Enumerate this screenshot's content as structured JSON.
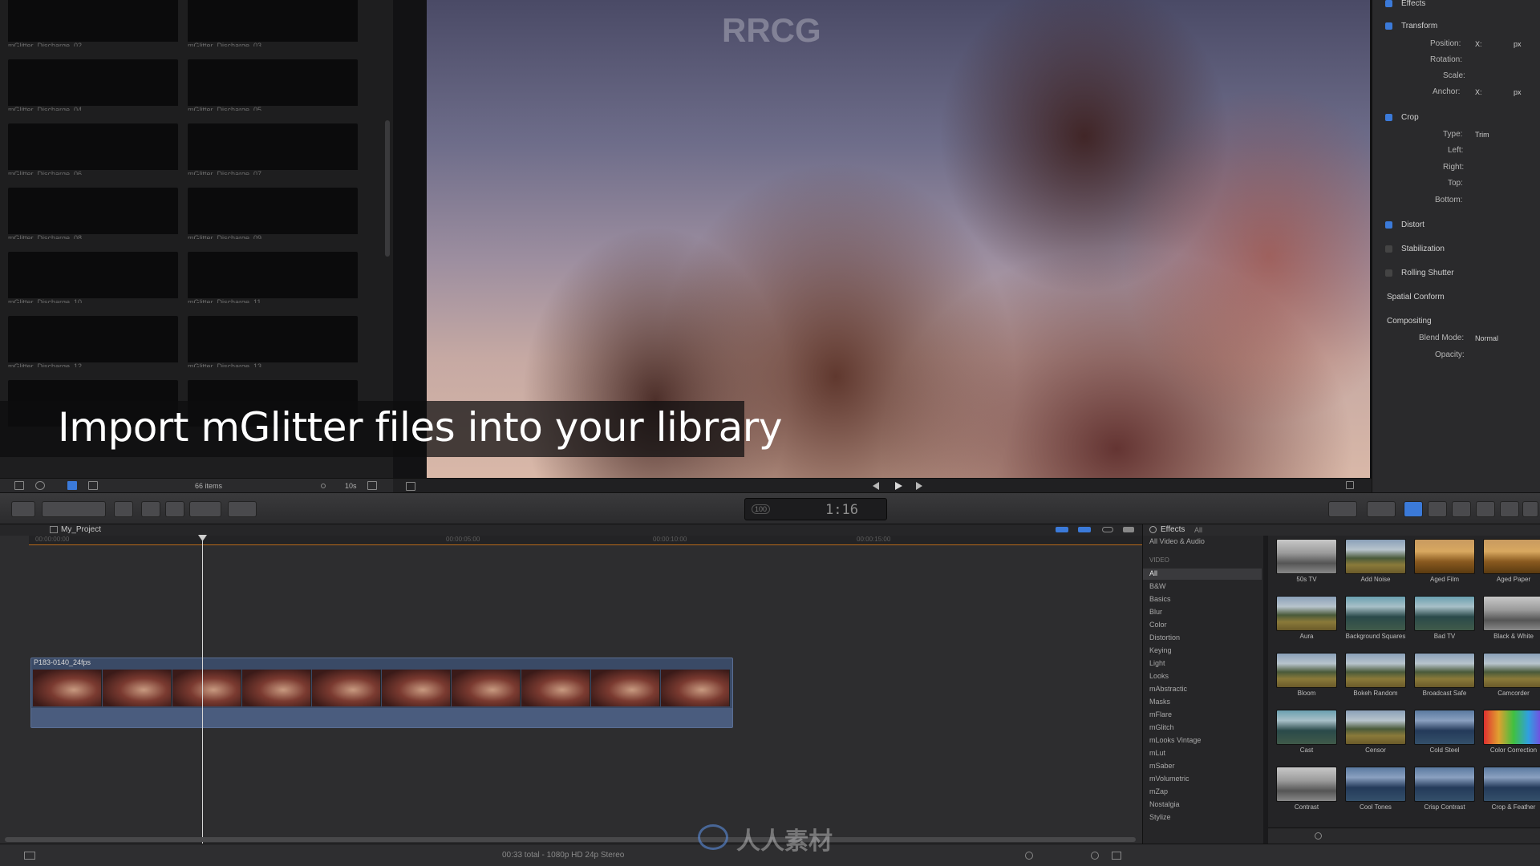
{
  "browser": {
    "clips": [
      {
        "name": "mGlitter_Discharge_02",
        "tint": "g-blue"
      },
      {
        "name": "mGlitter_Discharge_03",
        "tint": "g-stars"
      },
      {
        "name": "mGlitter_Discharge_04",
        "tint": "g-red"
      },
      {
        "name": "mGlitter_Discharge_05",
        "tint": "g-amber"
      },
      {
        "name": "mGlitter_Discharge_06",
        "tint": "g-dim"
      },
      {
        "name": "mGlitter_Discharge_07",
        "tint": "g-silver"
      },
      {
        "name": "mGlitter_Discharge_08",
        "tint": "g-gold"
      },
      {
        "name": "mGlitter_Discharge_09",
        "tint": "g-speck"
      },
      {
        "name": "mGlitter_Discharge_10",
        "tint": "g-cloud"
      },
      {
        "name": "mGlitter_Discharge_11",
        "tint": "g-cloud"
      },
      {
        "name": "mGlitter_Discharge_12",
        "tint": "g-smoke"
      },
      {
        "name": "mGlitter_Discharge_13",
        "tint": "g-smoke"
      }
    ],
    "items_count": "66 items",
    "clip_duration": "10s"
  },
  "caption": "Import mGlitter files into your library",
  "inspector": {
    "effects_label": "Effects",
    "transform": {
      "label": "Transform",
      "position": "Position:",
      "rotation": "Rotation:",
      "scale": "Scale:",
      "anchor": "Anchor:",
      "x": "X:",
      "px": "px"
    },
    "crop": {
      "label": "Crop",
      "type": "Type:",
      "type_value": "Trim",
      "left": "Left:",
      "right": "Right:",
      "top": "Top:",
      "bottom": "Bottom:"
    },
    "distort": "Distort",
    "stabilization": "Stabilization",
    "rolling_shutter": "Rolling Shutter",
    "spatial_conform": "Spatial Conform",
    "compositing": {
      "label": "Compositing",
      "blend_mode": "Blend Mode:",
      "blend_value": "Normal",
      "opacity": "Opacity:"
    }
  },
  "toolbar": {
    "timecode": "1:16",
    "timecode_badge": "100"
  },
  "timeline": {
    "project_name": "My_Project",
    "ruler": [
      "00:00:00:00",
      "00:00:05:00",
      "00:00:10:00",
      "00:00:15:00"
    ],
    "clip_name": "P183-0140_24fps"
  },
  "effects": {
    "title": "Effects",
    "filter": "All",
    "categories": [
      "All Video & Audio",
      "VIDEO",
      "All",
      "B&W",
      "Basics",
      "Blur",
      "Color",
      "Distortion",
      "Keying",
      "Light",
      "Looks",
      "mAbstractic",
      "Masks",
      "mFlare",
      "mGlitch",
      "mLooks Vintage",
      "mLut",
      "mSaber",
      "mVolumetric",
      "mZap",
      "Nostalgia",
      "Stylize"
    ],
    "items": [
      {
        "label": "50s TV",
        "style": "bw"
      },
      {
        "label": "Add Noise",
        "style": ""
      },
      {
        "label": "Aged Film",
        "style": "warm"
      },
      {
        "label": "Aged Paper",
        "style": "warm"
      },
      {
        "label": "Aura",
        "style": ""
      },
      {
        "label": "Background Squares",
        "style": "teal"
      },
      {
        "label": "Bad TV",
        "style": "teal"
      },
      {
        "label": "Black & White",
        "style": "bw"
      },
      {
        "label": "Bloom",
        "style": ""
      },
      {
        "label": "Bokeh Random",
        "style": ""
      },
      {
        "label": "Broadcast Safe",
        "style": ""
      },
      {
        "label": "Camcorder",
        "style": ""
      },
      {
        "label": "Cast",
        "style": "teal"
      },
      {
        "label": "Censor",
        "style": ""
      },
      {
        "label": "Cold Steel",
        "style": "cold"
      },
      {
        "label": "Color Correction",
        "style": "rainbow"
      },
      {
        "label": "Contrast",
        "style": "bw"
      },
      {
        "label": "Cool Tones",
        "style": "cold"
      },
      {
        "label": "Crisp Contrast",
        "style": "cold"
      },
      {
        "label": "Crop & Feather",
        "style": "cold"
      }
    ]
  },
  "status": "00:33 total - 1080p HD 24p Stereo",
  "watermark": {
    "top": "RRCG",
    "bottom": "人人素材"
  }
}
